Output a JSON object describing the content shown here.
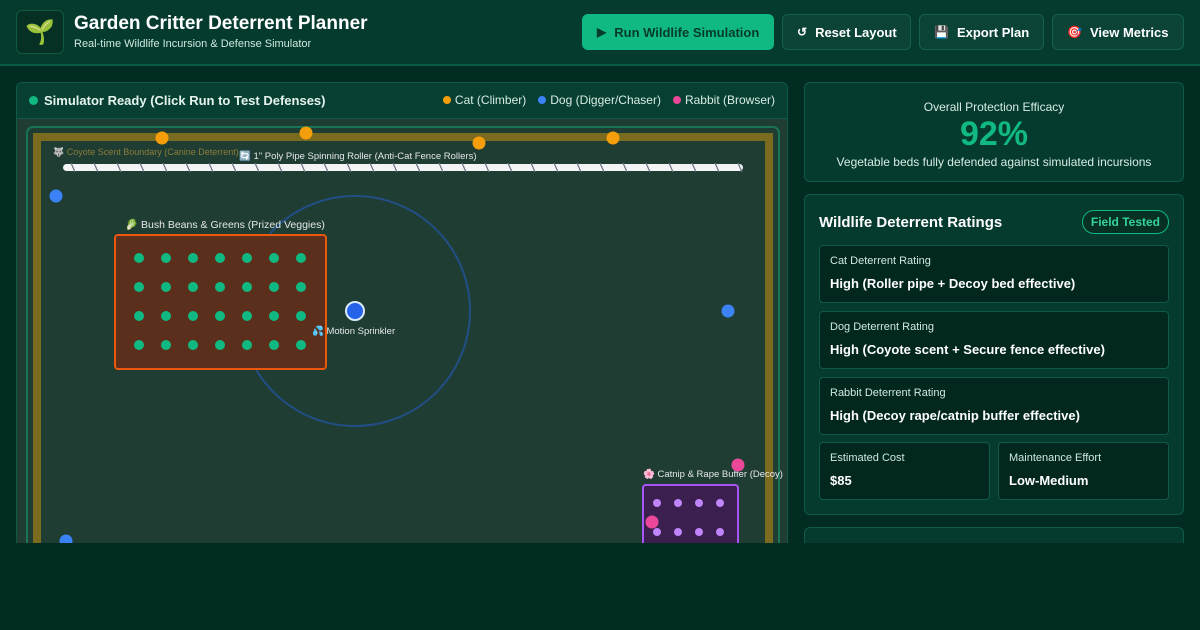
{
  "header": {
    "logo_icon": "seedling-icon",
    "title": "Garden Critter Deterrent Planner",
    "subtitle": "Real-time Wildlife Incursion & Defense Simulator",
    "buttons": {
      "run": {
        "icon": "▶",
        "label": "Run Wildlife Simulation"
      },
      "reset": {
        "icon": "↺",
        "label": "Reset Layout"
      },
      "export": {
        "icon": "💾",
        "label": "Export Plan"
      },
      "metrics": {
        "icon": "🎯",
        "label": "View Metrics"
      }
    }
  },
  "simulator": {
    "status": "Simulator Ready (Click Run to Test Defenses)",
    "legend": [
      {
        "label": "Cat (Climber)",
        "color": "#f59e0b"
      },
      {
        "label": "Dog (Digger/Chaser)",
        "color": "#3b82f6"
      },
      {
        "label": "Rabbit (Browser)",
        "color": "#ec4899"
      }
    ],
    "field": {
      "boundary_label": "🐺 Coyote Scent Boundary (Canine Deterrent)",
      "roller_label": "🔄 1\" Poly Pipe Spinning Roller (Anti-Cat Fence Rollers)",
      "bed_label": "🥬 Bush Beans & Greens (Prized Veggies)",
      "sprinkler_label": "💦 Motion Sprinkler",
      "decoy_label": "🌸 Catnip & Rape Buffer (Decoy)"
    }
  },
  "efficacy": {
    "label": "Overall Protection Efficacy",
    "value": "92%",
    "description": "Vegetable beds fully defended against simulated incursions"
  },
  "ratings": {
    "title": "Wildlife Deterrent Ratings",
    "badge": "Field Tested",
    "items": [
      {
        "label": "Cat Deterrent Rating",
        "value": "High (Roller pipe + Decoy bed effective)"
      },
      {
        "label": "Dog Deterrent Rating",
        "value": "High (Coyote scent + Secure fence effective)"
      },
      {
        "label": "Rabbit Deterrent Rating",
        "value": "High (Decoy rape/catnip buffer effective)"
      }
    ],
    "cost": {
      "label": "Estimated Cost",
      "value": "$85"
    },
    "maintenance": {
      "label": "Maintenance Effort",
      "value": "Low-Medium"
    }
  },
  "colors": {
    "accent": "#10b981",
    "cat": "#f59e0b",
    "dog": "#3b82f6",
    "rabbit": "#ec4899",
    "sprinkler": "#2563eb",
    "decoy": "#a855f7",
    "bed": "#ea580c",
    "fence": "#7a6b1f"
  }
}
